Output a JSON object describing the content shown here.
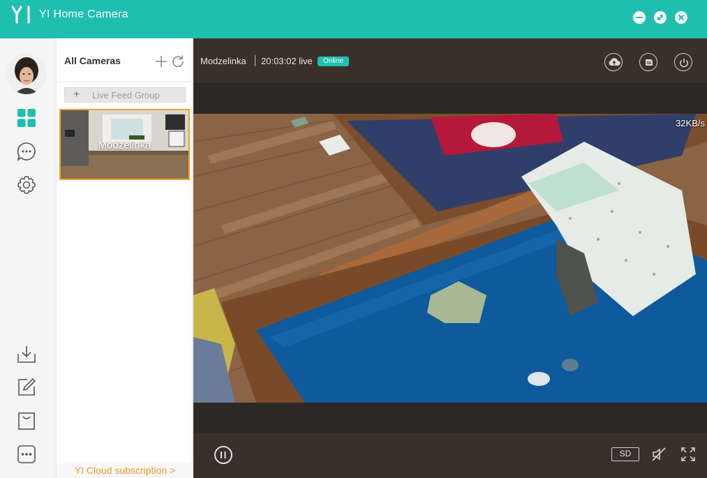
{
  "window": {
    "title": "YI Home Camera",
    "logo_text": "YI"
  },
  "rail": {
    "icons": [
      "avatar",
      "grid-icon",
      "chat-icon",
      "settings-gear-icon",
      "download-icon",
      "edit-icon",
      "shop-bag-icon",
      "more-icon"
    ]
  },
  "panel": {
    "title": "All Cameras",
    "group_button_label": "Live Feed Group",
    "cameras": [
      {
        "name": "Modzelinka",
        "selected": true
      }
    ],
    "cloud_link": "YI Cloud subscription >"
  },
  "viewer": {
    "camera_name": "Modzelinka",
    "time_status": "20:03:02 live",
    "status_badge": "Online",
    "bitrate": "32KB/s",
    "quality_button": "SD",
    "header_icons": [
      "cloud-upload-icon",
      "sd-card-icon",
      "power-icon"
    ],
    "control_icons": [
      "pause-icon",
      "mute-icon",
      "fullscreen-icon"
    ]
  },
  "colors": {
    "accent": "#1fbfb0",
    "selection": "#f4a12e",
    "link": "#f39a2b",
    "viewer_bg": "#3a302a"
  }
}
